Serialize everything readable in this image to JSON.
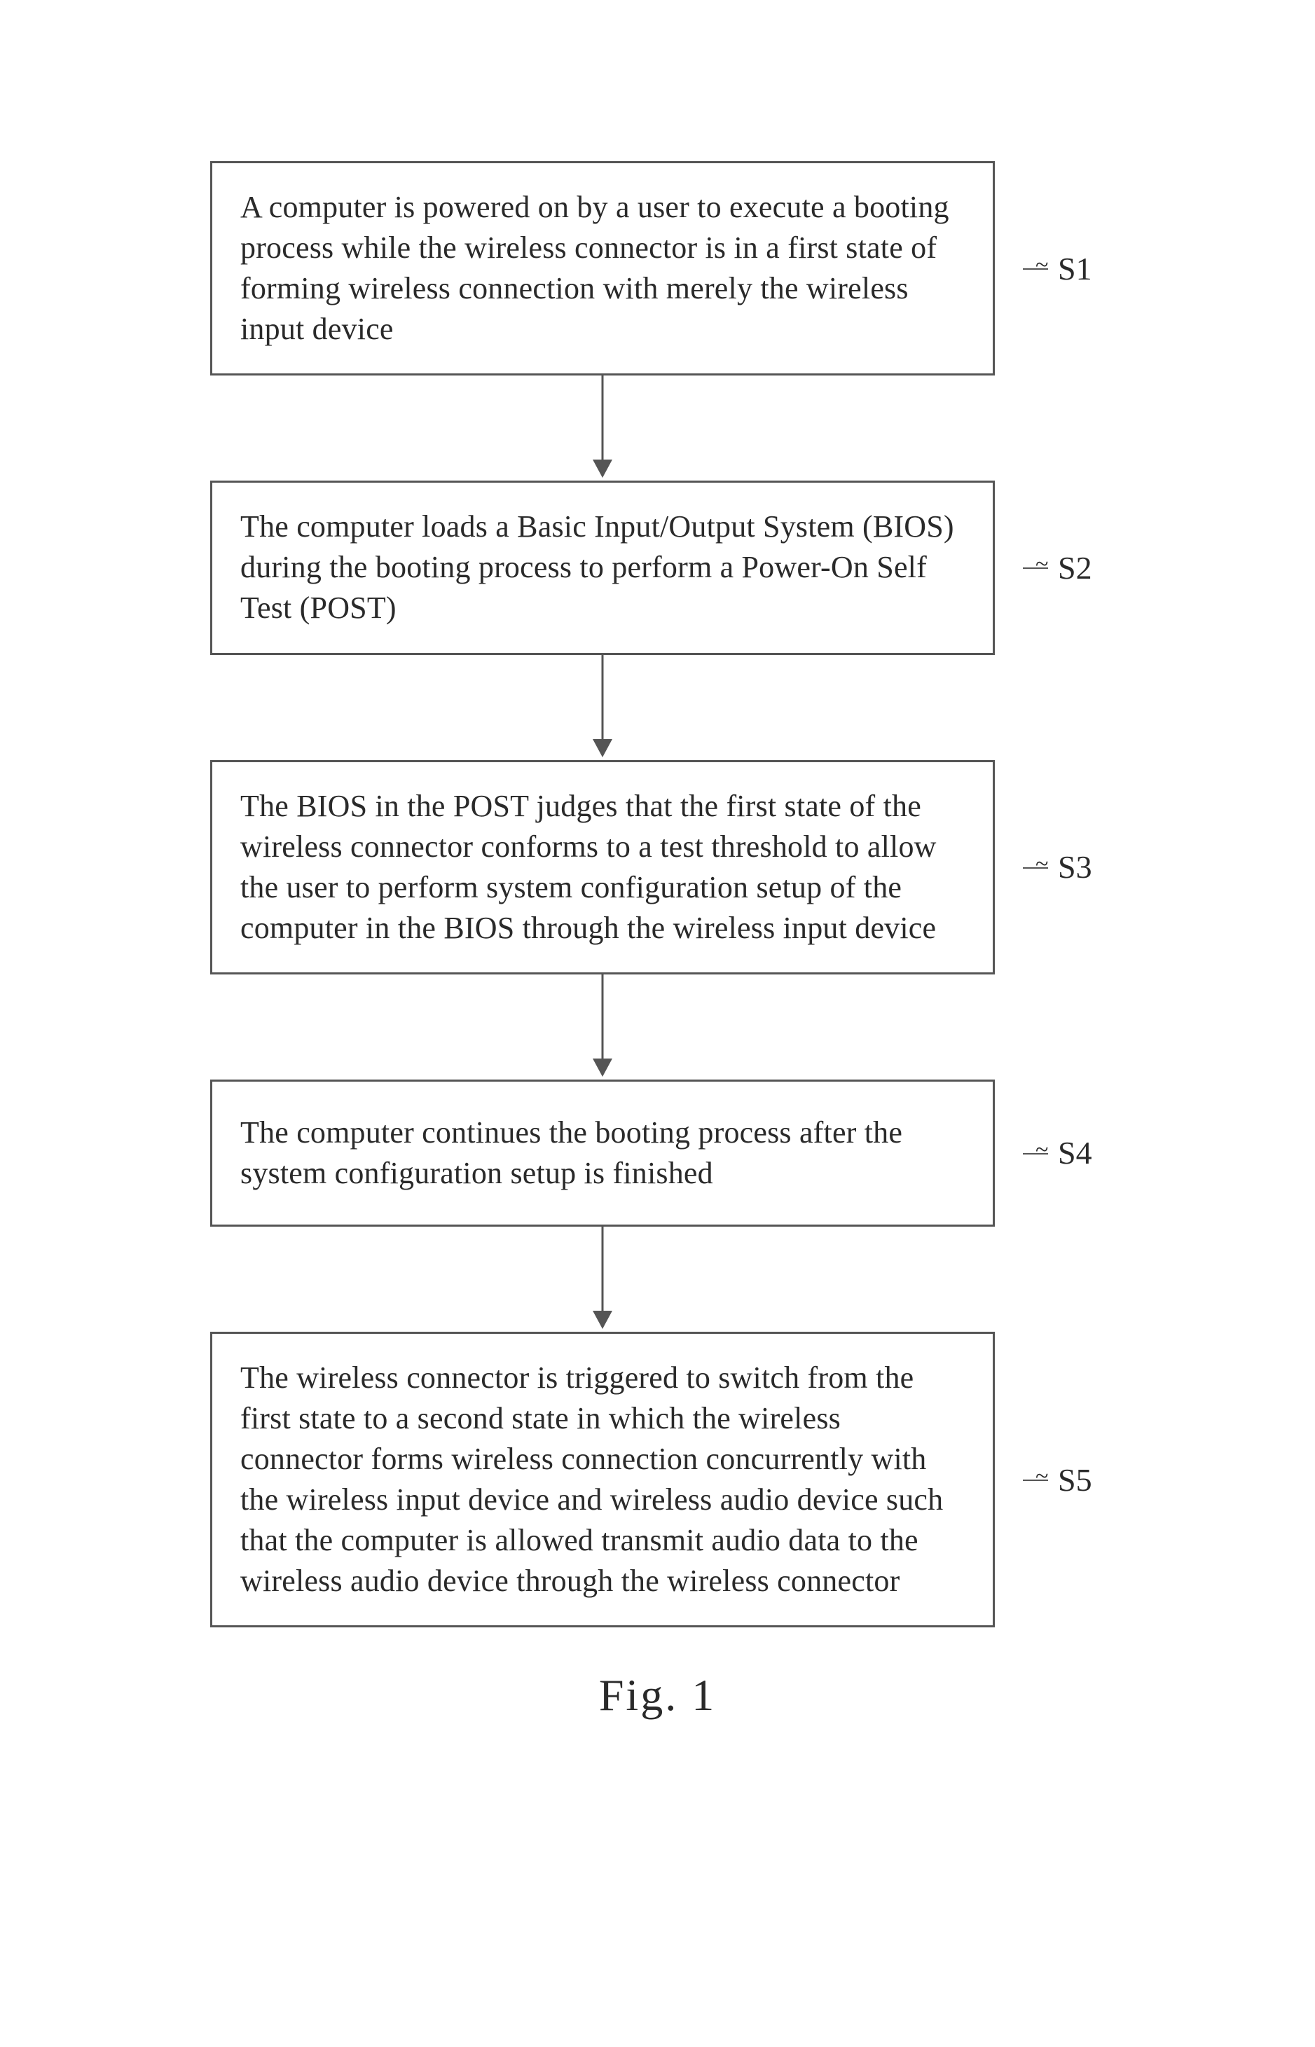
{
  "steps": [
    {
      "id": "S1",
      "text": "A computer is powered on by a user to execute a booting process while the wireless connector is in a first state of forming wireless connection with merely the wireless input device"
    },
    {
      "id": "S2",
      "text": "The computer loads a Basic Input/Output System (BIOS) during the booting process to perform a Power-On Self Test (POST)"
    },
    {
      "id": "S3",
      "text": "The BIOS in the POST judges that the first state of the wireless connector conforms to a test threshold to allow the user to perform system configuration setup of the computer in the BIOS through the wireless input device"
    },
    {
      "id": "S4",
      "text": "The computer continues the booting process after the system configuration setup is finished"
    },
    {
      "id": "S5",
      "text": "The wireless connector is triggered to switch from the first state to a second state in which the wireless connector forms wireless connection concurrently with the wireless input device and wireless audio device such that the computer is allowed transmit audio data to the wireless audio device through the wireless connector"
    }
  ],
  "caption": "Fig. 1"
}
